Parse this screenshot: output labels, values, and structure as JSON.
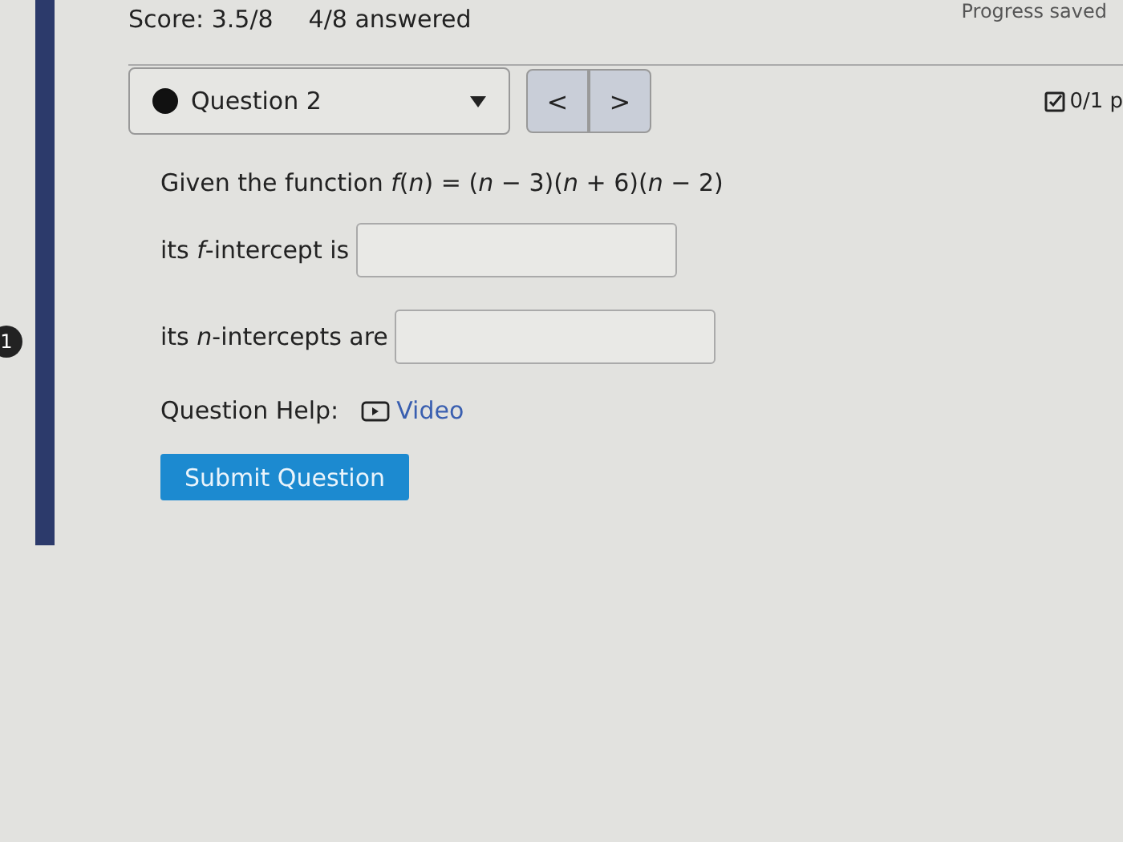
{
  "header": {
    "score": "Score: 3.5/8",
    "answered": "4/8 answered",
    "progress": "Progress saved"
  },
  "side_badge": "1",
  "question_select": {
    "label": "Question 2",
    "completed": true
  },
  "nav": {
    "prev": "<",
    "next": ">"
  },
  "points": "0/1 p",
  "question": {
    "prompt": "Given the function *f*(*n*) = (*n* − 3)(*n* + 6)(*n* − 2)",
    "fields": [
      {
        "label": "its *f*-intercept is"
      },
      {
        "label": "its *n*-intercepts are"
      }
    ]
  },
  "help": {
    "label": "Question Help:",
    "link": "Video"
  },
  "submit": "Submit Question"
}
